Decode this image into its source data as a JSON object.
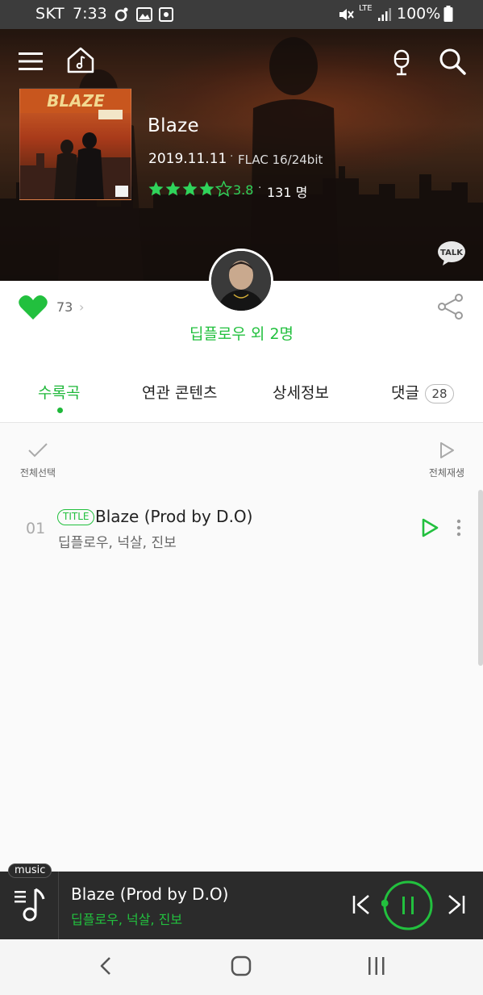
{
  "status_bar": {
    "carrier": "SKT",
    "time": "7:33",
    "network": "LTE",
    "battery": "100%"
  },
  "album": {
    "title": "Blaze",
    "release_date": "2019.11.11",
    "format": "FLAC 16/24bit",
    "rating": "3.8",
    "rating_stars": 4,
    "rating_count": "131 명",
    "talk_label": "TALK"
  },
  "artist": {
    "name": "딥플로우 외 2명",
    "likes": "73"
  },
  "tabs": [
    {
      "label": "수록곡",
      "active": true
    },
    {
      "label": "연관 콘텐츠",
      "active": false
    },
    {
      "label": "상세정보",
      "active": false
    },
    {
      "label": "댓글",
      "active": false,
      "badge": "28"
    }
  ],
  "list_controls": {
    "select_all": "전체선택",
    "play_all": "전체재생"
  },
  "tracks": [
    {
      "number": "01",
      "badge": "TITLE",
      "title": "Blaze (Prod by D.O)",
      "artists": "딥플로우, 넉살, 진보"
    }
  ],
  "mini_player": {
    "tag": "music",
    "title": "Blaze (Prod by D.O)",
    "artists": "딥플로우, 넉살, 진보",
    "progress": 0.03
  },
  "colors": {
    "accent": "#22c03e",
    "status_bar": "#3c3c3c",
    "mini_player_bg": "#2b2b2b"
  },
  "icons": {
    "menu": "menu-icon",
    "home": "music-home-icon",
    "mic": "microphone-icon",
    "search": "search-icon",
    "talk": "talk-bubble-icon",
    "like": "heart-icon",
    "share": "share-icon",
    "check": "check-icon",
    "play": "play-icon",
    "more": "more-vertical-icon",
    "playlist": "playlist-note-icon",
    "prev": "previous-icon",
    "pause": "pause-icon",
    "next": "next-icon",
    "back": "back-icon",
    "nav_home": "home-icon",
    "recents": "recents-icon"
  }
}
